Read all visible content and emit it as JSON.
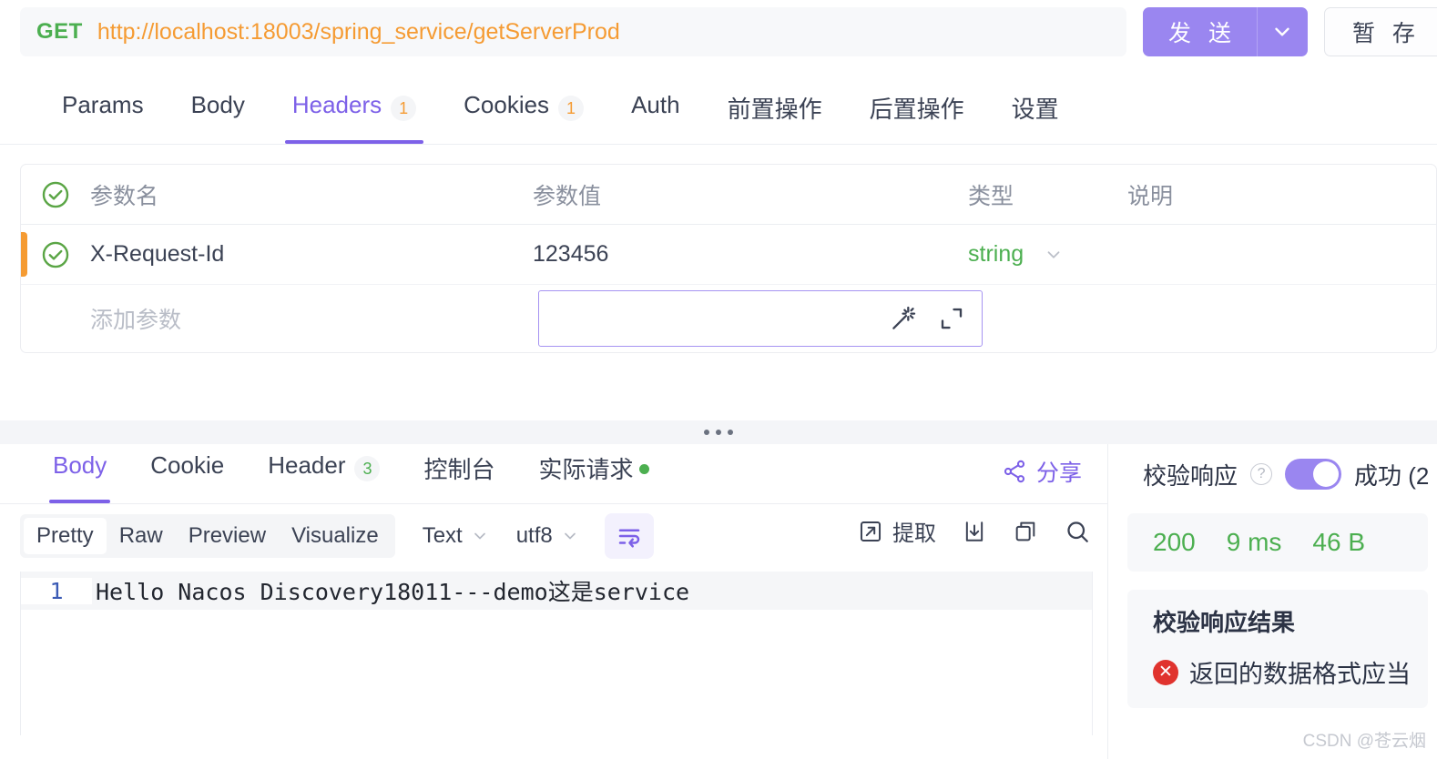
{
  "request_bar": {
    "method": "GET",
    "url": "http://localhost:18003/spring_service/getServerProd",
    "send_label": "发 送",
    "save_label": "暂 存",
    "send_caret_icon": "chevron-down-icon"
  },
  "request_tabs": [
    {
      "label": "Params",
      "badge": "",
      "active": false
    },
    {
      "label": "Body",
      "badge": "",
      "active": false
    },
    {
      "label": "Headers",
      "badge": "1",
      "active": true
    },
    {
      "label": "Cookies",
      "badge": "1",
      "active": false
    },
    {
      "label": "Auth",
      "badge": "",
      "active": false
    },
    {
      "label": "前置操作",
      "badge": "",
      "active": false
    },
    {
      "label": "后置操作",
      "badge": "",
      "active": false
    },
    {
      "label": "设置",
      "badge": "",
      "active": false
    }
  ],
  "param_table": {
    "columns": {
      "name": "参数名",
      "value": "参数值",
      "type": "类型",
      "desc": "说明"
    },
    "rows": [
      {
        "name": "X-Request-Id",
        "value": "123456",
        "type": "string",
        "desc": ""
      }
    ],
    "add_placeholder": "添加参数",
    "magic_icon": "magic-wand-icon",
    "expand_icon": "expand-icon",
    "check_icon": "check-circle-icon",
    "marker_color": "#f59b33"
  },
  "response_tabs": [
    {
      "label": "Body",
      "badge": "",
      "active": true,
      "dot": false
    },
    {
      "label": "Cookie",
      "badge": "",
      "active": false,
      "dot": false
    },
    {
      "label": "Header",
      "badge": "3",
      "active": false,
      "dot": false
    },
    {
      "label": "控制台",
      "badge": "",
      "active": false,
      "dot": false
    },
    {
      "label": "实际请求",
      "badge": "",
      "active": false,
      "dot": true
    }
  ],
  "share": {
    "label": "分享",
    "icon": "share-icon"
  },
  "body_toolbar": {
    "view_modes": [
      {
        "label": "Pretty",
        "active": true
      },
      {
        "label": "Raw",
        "active": false
      },
      {
        "label": "Preview",
        "active": false
      },
      {
        "label": "Visualize",
        "active": false
      }
    ],
    "format_select": "Text",
    "encoding_select": "utf8",
    "wrap_icon": "word-wrap-icon",
    "extract_label": "提取",
    "extract_icon": "extract-icon",
    "download_icon": "download-icon",
    "copy_icon": "copy-icon",
    "search_icon": "search-icon"
  },
  "response_body": {
    "lines": [
      {
        "number": "1",
        "text": "Hello Nacos Discovery18011---demo这是service"
      }
    ]
  },
  "verify_panel": {
    "label": "校验响应",
    "help_icon": "help-circle-icon",
    "toggle_on": true,
    "status": "成功 (2",
    "stats": {
      "status_code": "200",
      "time": "9 ms",
      "size": "46 B"
    },
    "result_title": "校验响应结果",
    "result_error": "返回的数据格式应当",
    "error_icon": "error-circle-icon"
  },
  "watermark": "CSDN @苍云烟",
  "colors": {
    "accent": "#7d61e8",
    "send": "#9a86f0",
    "method_green": "#4caf50",
    "url_orange": "#f59b33",
    "error_red": "#e0332e"
  }
}
